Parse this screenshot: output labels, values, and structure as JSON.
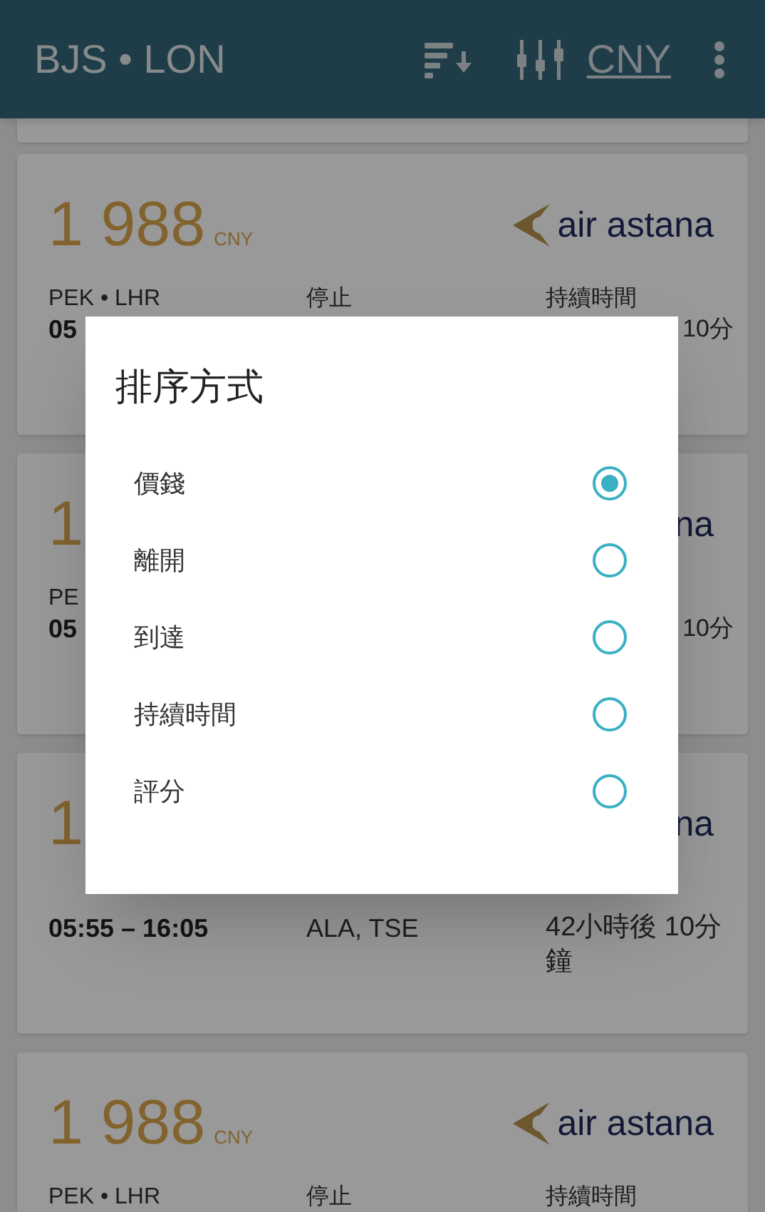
{
  "app_bar": {
    "title": "BJS • LON",
    "currency": "CNY"
  },
  "flights": [
    {
      "kind": "full",
      "price": "1 988",
      "currency": "CNY",
      "airline": "air astana",
      "route_label": "PEK • LHR",
      "stops_label": "停止",
      "duration_label": "持續時間",
      "times": "05",
      "duration": "10分",
      "wrap": false
    },
    {
      "kind": "covered",
      "price": "1",
      "airline": "na",
      "route_label": "PE",
      "times": "05",
      "duration": "10分",
      "wrap": false
    },
    {
      "kind": "covered",
      "price": "1",
      "airline": "na",
      "times": "05:55 – 16:05",
      "stops": "ALA, TSE",
      "duration": "42小時後 10分鐘",
      "wrap": true
    },
    {
      "kind": "full",
      "price": "1 988",
      "currency": "CNY",
      "airline": "air astana",
      "route_label": "PEK • LHR",
      "stops_label": "停止",
      "duration_label": "持續時間"
    }
  ],
  "sort_dialog": {
    "title": "排序方式",
    "options": [
      {
        "label": "價錢",
        "selected": true
      },
      {
        "label": "離開",
        "selected": false
      },
      {
        "label": "到達",
        "selected": false
      },
      {
        "label": "持續時間",
        "selected": false
      },
      {
        "label": "評分",
        "selected": false
      }
    ]
  }
}
